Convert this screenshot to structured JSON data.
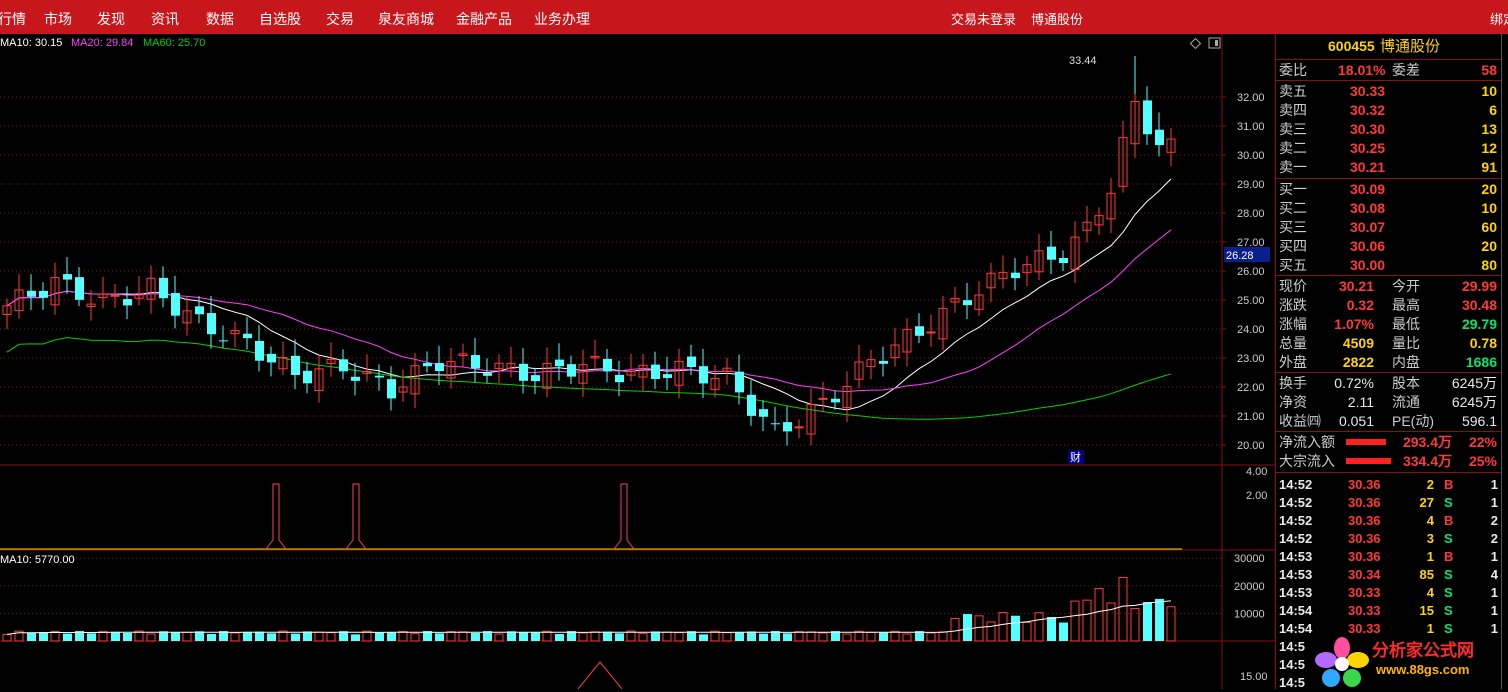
{
  "topbar": {
    "nav": [
      "行情",
      "市场",
      "发现",
      "资讯",
      "数据",
      "自选股",
      "交易",
      "泉友商城",
      "金融产品",
      "业务办理"
    ],
    "login_status": "交易未登录",
    "stock_name": "博通股份",
    "corner": "绑定"
  },
  "chart": {
    "ma_legend": {
      "ma10": "MA10: 30.15",
      "ma20": "MA20: 29.84",
      "ma60": "MA60: 25.70"
    },
    "price_axis": [
      "32.00",
      "31.00",
      "30.00",
      "29.00",
      "28.00",
      "27.00",
      "26.00",
      "25.00",
      "24.00",
      "23.00",
      "22.00",
      "21.00",
      "20.00"
    ],
    "current_price_tag": "26.28",
    "high_label": "33.44",
    "finance_marker": "财",
    "indicator_axis": [
      "4.00",
      "2.00"
    ],
    "volume_legend": "MA10: 5770.00",
    "volume_axis": [
      "30000",
      "20000",
      "10000"
    ],
    "bottom_axis": [
      "15.00"
    ],
    "colors": {
      "up": "#ff3b3b",
      "down": "#54ffff",
      "ma10": "#ffffff",
      "ma20": "#ff40ff",
      "ma60": "#00d000",
      "grid": "#8a1010"
    }
  },
  "panel": {
    "code": "600455",
    "name": "博通股份",
    "weibi_label": "委比",
    "weibi": "18.01%",
    "weicha_label": "委差",
    "weicha": "58",
    "asks": [
      {
        "label": "卖五",
        "price": "30.33",
        "vol": "10"
      },
      {
        "label": "卖四",
        "price": "30.32",
        "vol": "6"
      },
      {
        "label": "卖三",
        "price": "30.30",
        "vol": "13"
      },
      {
        "label": "卖二",
        "price": "30.25",
        "vol": "12"
      },
      {
        "label": "卖一",
        "price": "30.21",
        "vol": "91"
      }
    ],
    "bids": [
      {
        "label": "买一",
        "price": "30.09",
        "vol": "20"
      },
      {
        "label": "买二",
        "price": "30.08",
        "vol": "10"
      },
      {
        "label": "买三",
        "price": "30.07",
        "vol": "60"
      },
      {
        "label": "买四",
        "price": "30.06",
        "vol": "20"
      },
      {
        "label": "买五",
        "price": "30.00",
        "vol": "80"
      }
    ],
    "stats": [
      {
        "l1": "现价",
        "v1": "30.21",
        "l2": "今开",
        "v2": "29.99"
      },
      {
        "l1": "涨跌",
        "v1": "0.32",
        "l2": "最高",
        "v2": "30.48"
      },
      {
        "l1": "涨幅",
        "v1": "1.07%",
        "l2": "最低",
        "v2": "29.79"
      },
      {
        "l1": "总量",
        "v1": "4509",
        "l2": "量比",
        "v2": "0.78"
      },
      {
        "l1": "外盘",
        "v1": "2822",
        "l2": "内盘",
        "v2": "1686"
      }
    ],
    "stats2": [
      {
        "l1": "换手",
        "v1": "0.72%",
        "l2": "股本",
        "v2": "6245万"
      },
      {
        "l1": "净资",
        "v1": "2.11",
        "l2": "流通",
        "v2": "6245万"
      },
      {
        "l1": "收益㈣",
        "v1": "0.051",
        "l2": "PE(动)",
        "v2": "596.1"
      }
    ],
    "flows": [
      {
        "label": "净流入额",
        "value": "293.4万",
        "pct": "22%",
        "fill": 0.22
      },
      {
        "label": "大宗流入",
        "value": "334.4万",
        "pct": "25%",
        "fill": 0.25
      }
    ],
    "trades": [
      {
        "time": "14:52",
        "price": "30.36",
        "vol": "2",
        "side": "B",
        "n": "1"
      },
      {
        "time": "14:52",
        "price": "30.36",
        "vol": "27",
        "side": "S",
        "n": "1"
      },
      {
        "time": "14:52",
        "price": "30.36",
        "vol": "4",
        "side": "B",
        "n": "2"
      },
      {
        "time": "14:52",
        "price": "30.36",
        "vol": "3",
        "side": "S",
        "n": "2"
      },
      {
        "time": "14:53",
        "price": "30.36",
        "vol": "1",
        "side": "B",
        "n": "1"
      },
      {
        "time": "14:53",
        "price": "30.34",
        "vol": "85",
        "side": "S",
        "n": "4"
      },
      {
        "time": "14:53",
        "price": "30.33",
        "vol": "4",
        "side": "S",
        "n": "1"
      },
      {
        "time": "14:54",
        "price": "30.33",
        "vol": "15",
        "side": "S",
        "n": "1"
      },
      {
        "time": "14:54",
        "price": "30.33",
        "vol": "1",
        "side": "S",
        "n": "1"
      },
      {
        "time": "14:5",
        "price": "",
        "vol": "",
        "side": "",
        "n": ""
      },
      {
        "time": "14:5",
        "price": "",
        "vol": "",
        "side": "",
        "n": ""
      },
      {
        "time": "14:5",
        "price": "",
        "vol": "",
        "side": "",
        "n": ""
      }
    ]
  },
  "watermark": {
    "title": "分析家公式网",
    "url": "www.88gs.com"
  }
}
